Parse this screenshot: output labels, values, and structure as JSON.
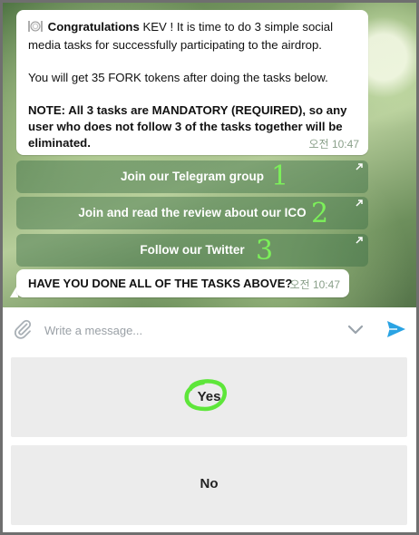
{
  "messages": {
    "first": {
      "icon": "plate-cutlery-icon",
      "congrats_bold": "Congratulations",
      "congrats_rest": " KEV !  It is time to do 3 simple social media tasks for successfully participating to the airdrop.",
      "tokens_line": "You will get 35 FORK tokens after doing the tasks below.",
      "note_bold": "NOTE:  All 3 tasks are MANDATORY (REQUIRED), so any user who does not follow 3 of the tasks together will be eliminated.",
      "time": "오전 10:47"
    },
    "second": {
      "text": "HAVE YOU DONE ALL OF THE TASKS ABOVE?",
      "time": "오전 10:47"
    }
  },
  "inline_buttons": [
    {
      "label": "Join our Telegram group",
      "annotation": "1"
    },
    {
      "label": "Join and read the review about our ICO",
      "annotation": "2"
    },
    {
      "label": "Follow our Twitter",
      "annotation": "3"
    }
  ],
  "composer": {
    "placeholder": "Write a message...",
    "attach_icon": "paperclip-icon",
    "toggle_icon": "chevron-down-icon",
    "send_icon": "send-icon"
  },
  "keyboard": {
    "yes": "Yes",
    "no": "No"
  },
  "colors": {
    "send": "#2aa3e3",
    "annotation": "#7cf05a",
    "inline_button_bg": "rgba(60,110,70,0.45)",
    "keyboard_button_bg": "#ececec"
  }
}
